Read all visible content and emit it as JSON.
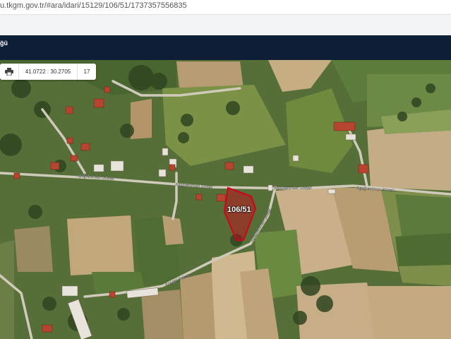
{
  "browser": {
    "url": "u.tkgm.gov.tr/#ara/idari/15129/106/51/1737357556835"
  },
  "navbar": {
    "title": "ğü"
  },
  "toolbar": {
    "coordinates": "41.0722 : 30.2705",
    "zoom": "17",
    "print_icon": "printer-icon"
  },
  "map": {
    "parcel_label": "106/51",
    "parcel_color": "#d0021b",
    "streets": [
      "Aşağıeniman Sokak",
      "Aşağıeniman Sokak",
      "Aşağıeniman Sokak",
      "Aşağıeniman Sokak",
      "Aşağıeniman Sokak",
      "Koçgol Sokak"
    ]
  }
}
